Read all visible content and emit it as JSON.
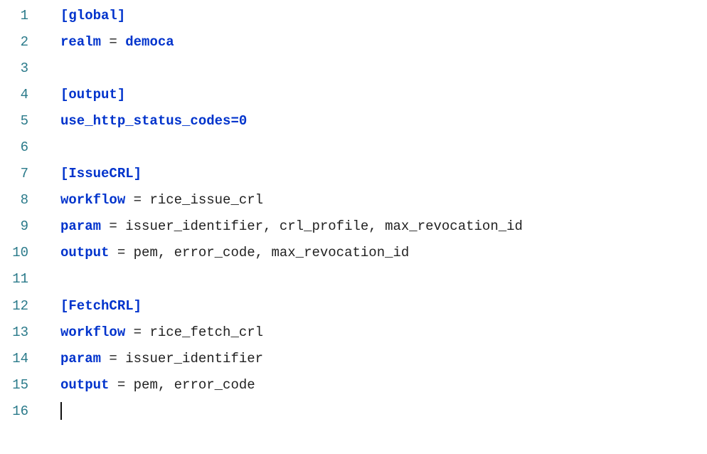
{
  "lines": [
    {
      "num": "1",
      "tokens": [
        {
          "t": "section",
          "v": "[global]"
        }
      ]
    },
    {
      "num": "2",
      "tokens": [
        {
          "t": "key",
          "v": "realm"
        },
        {
          "t": "eq",
          "v": " = "
        },
        {
          "t": "key",
          "v": "democa"
        }
      ]
    },
    {
      "num": "3",
      "tokens": []
    },
    {
      "num": "4",
      "tokens": [
        {
          "t": "section",
          "v": "[output]"
        }
      ]
    },
    {
      "num": "5",
      "tokens": [
        {
          "t": "key",
          "v": "use_http_status_codes=0"
        }
      ]
    },
    {
      "num": "6",
      "tokens": []
    },
    {
      "num": "7",
      "tokens": [
        {
          "t": "section",
          "v": "[IssueCRL]"
        }
      ]
    },
    {
      "num": "8",
      "tokens": [
        {
          "t": "key",
          "v": "workflow"
        },
        {
          "t": "eq",
          "v": " = "
        },
        {
          "t": "val",
          "v": "rice_issue_crl"
        }
      ]
    },
    {
      "num": "9",
      "tokens": [
        {
          "t": "key",
          "v": "param"
        },
        {
          "t": "eq",
          "v": " = "
        },
        {
          "t": "val",
          "v": "issuer_identifier, crl_profile, max_revocation_id"
        }
      ]
    },
    {
      "num": "10",
      "tokens": [
        {
          "t": "key",
          "v": "output"
        },
        {
          "t": "eq",
          "v": " = "
        },
        {
          "t": "val",
          "v": "pem, error_code, max_revocation_id"
        }
      ]
    },
    {
      "num": "11",
      "tokens": []
    },
    {
      "num": "12",
      "tokens": [
        {
          "t": "section",
          "v": "[FetchCRL]"
        }
      ]
    },
    {
      "num": "13",
      "tokens": [
        {
          "t": "key",
          "v": "workflow"
        },
        {
          "t": "eq",
          "v": " = "
        },
        {
          "t": "val",
          "v": "rice_fetch_crl"
        }
      ]
    },
    {
      "num": "14",
      "tokens": [
        {
          "t": "key",
          "v": "param"
        },
        {
          "t": "eq",
          "v": " = "
        },
        {
          "t": "val",
          "v": "issuer_identifier"
        }
      ]
    },
    {
      "num": "15",
      "tokens": [
        {
          "t": "key",
          "v": "output"
        },
        {
          "t": "eq",
          "v": " = "
        },
        {
          "t": "val",
          "v": "pem, error_code"
        }
      ]
    },
    {
      "num": "16",
      "tokens": [],
      "cursor": true
    }
  ]
}
